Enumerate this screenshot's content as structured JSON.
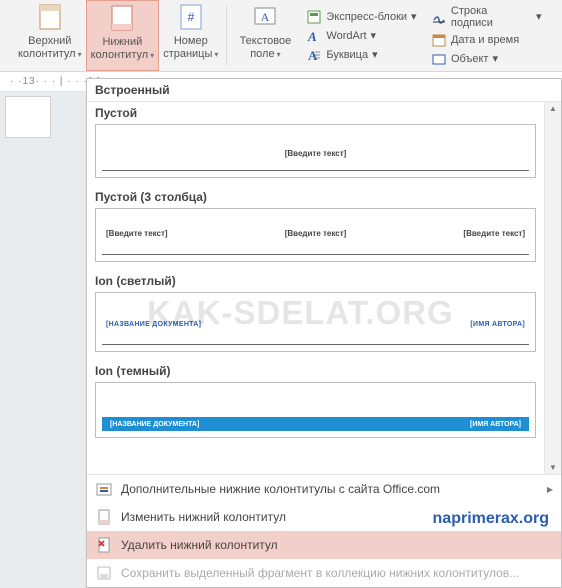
{
  "ribbon": {
    "header_footer": {
      "top": {
        "line1": "Верхний",
        "line2": "колонтитул"
      },
      "bottom": {
        "line1": "Нижний",
        "line2": "колонтитул"
      },
      "page_no": {
        "line1": "Номер",
        "line2": "страницы"
      }
    },
    "text_block": {
      "textbox": {
        "line1": "Текстовое",
        "line2": "поле"
      }
    },
    "right_col1": {
      "quick_parts": "Экспресс-блоки",
      "wordart": "WordArt",
      "dropcap": "Буквица"
    },
    "right_col2": {
      "signature": "Строка подписи",
      "datetime": "Дата и время",
      "object": "Объект"
    }
  },
  "ruler": "· ·13· · · | · · ·14· ·",
  "gallery": {
    "built_in_label": "Встроенный",
    "items": [
      {
        "title": "Пустой",
        "cells": [
          "[Введите текст]"
        ]
      },
      {
        "title": "Пустой (3 столбца)",
        "cells": [
          "[Введите текст]",
          "[Введите текст]",
          "[Введите текст]"
        ]
      },
      {
        "title": "Ion (светлый)",
        "cells": [
          "[НАЗВАНИЕ ДОКУМЕНТА]",
          "[ИМЯ АВТОРА]"
        ]
      },
      {
        "title": "Ion (темный)",
        "cells": [
          "[НАЗВАНИЕ ДОКУМЕНТА]",
          "[ИМЯ АВТОРА]"
        ]
      }
    ]
  },
  "menu": {
    "more_office": "Дополнительные нижние колонтитулы с сайта Office.com",
    "edit_footer": "Изменить нижний колонтитул",
    "remove_footer": "Удалить нижний колонтитул",
    "save_selection": "Сохранить выделенный фрагмент в коллекцию нижних колонтитулов..."
  },
  "watermarks": {
    "center": "KAK-SDELAT.ORG",
    "brand": "naprimerax.org"
  }
}
